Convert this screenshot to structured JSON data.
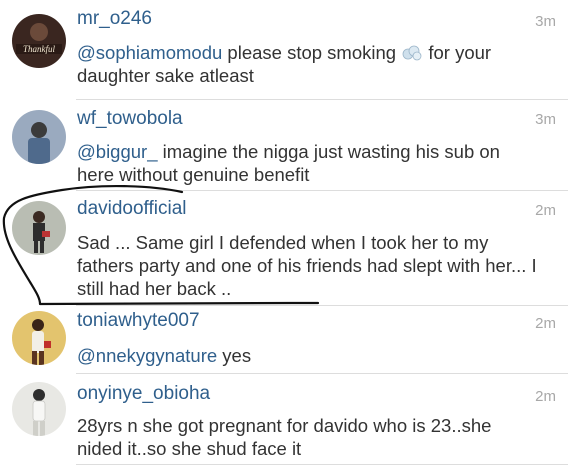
{
  "comments": [
    {
      "username": "mr_o246",
      "time": "3m",
      "mention": "@sophiamomodu",
      "text_before_icon": " please stop smoking ",
      "icon": "smoke-emoji-icon",
      "text_after_icon": " for your daughter sake atleast",
      "avatar_text": "Thankful",
      "avatar_color": "#3a2620"
    },
    {
      "username": "wf_towobola",
      "time": "3m",
      "mention": "@biggur_",
      "text": " imagine the nigga just wasting his sub on here without genuine benefit",
      "avatar_color": "#6b7f99"
    },
    {
      "username": "davidoofficial",
      "time": "2m",
      "text": "Sad ... Same girl I defended when I took her to my fathers party and one of his friends had slept with her... I still had her back ..",
      "avatar_color": "#8c8f86"
    },
    {
      "username": "toniawhyte007",
      "time": "2m",
      "mention": "@nnekygynature",
      "text": " yes",
      "avatar_color": "#d9b65a"
    },
    {
      "username": "onyinye_obioha",
      "time": "2m",
      "text": "28yrs n she got pregnant for davido who is 23..she nided it..so she shud face it",
      "avatar_color": "#dcdcd8"
    }
  ],
  "colors": {
    "username": "#2f5f8c",
    "mention": "#2f5f8c",
    "body_text": "#333333",
    "timestamp": "#a8a8a8",
    "annotation_ink": "#111111"
  }
}
